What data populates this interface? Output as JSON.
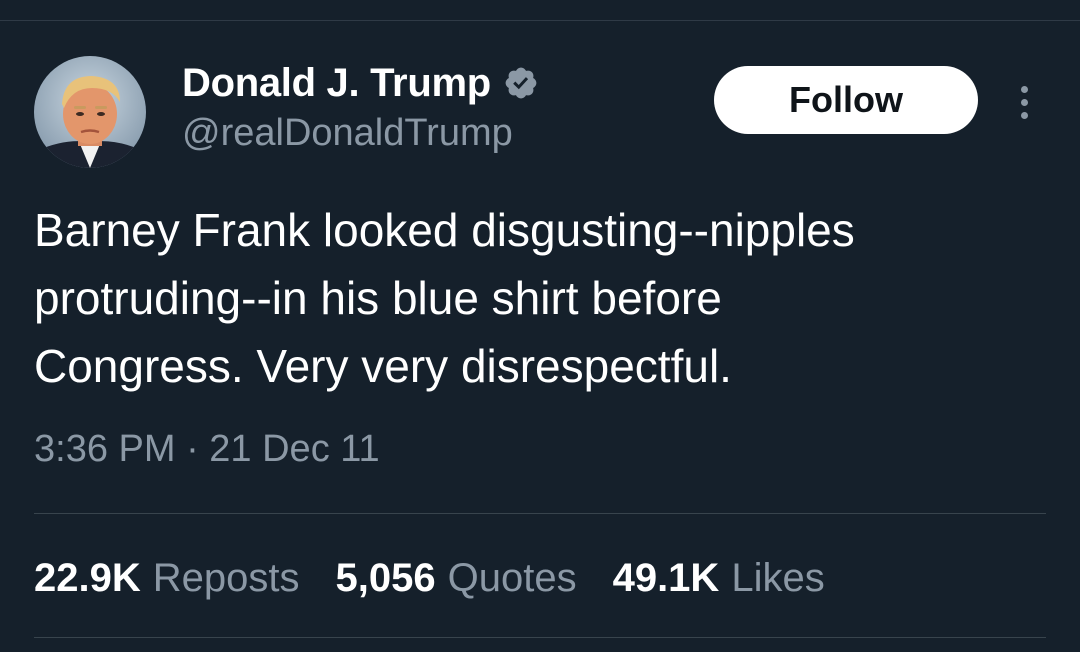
{
  "author": {
    "display_name": "Donald J. Trump",
    "handle": "@realDonaldTrump",
    "verified_icon": "verified-badge-icon",
    "avatar_icon": "profile-photo"
  },
  "actions": {
    "follow_label": "Follow",
    "more_icon": "more-vertical-icon"
  },
  "tweet": {
    "text": "Barney Frank looked disgusting--nipples\nprotruding--in his blue shirt before\nCongress. Very very disrespectful.",
    "timestamp": "3:36 PM · 21 Dec 11"
  },
  "stats": [
    {
      "value": "22.9K",
      "label": "Reposts"
    },
    {
      "value": "5,056",
      "label": "Quotes"
    },
    {
      "value": "49.1K",
      "label": "Likes"
    }
  ],
  "colors": {
    "background": "#15202b",
    "text_primary": "#ffffff",
    "text_secondary": "#8b98a5",
    "divider": "#38444d",
    "follow_bg": "#ffffff",
    "follow_text": "#0f1419"
  }
}
